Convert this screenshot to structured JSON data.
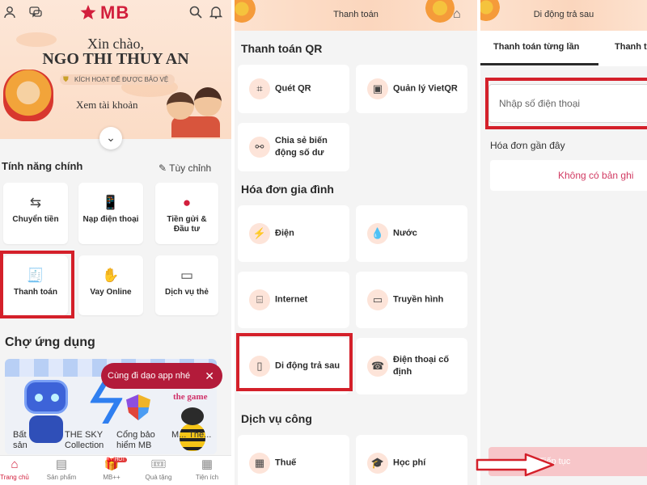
{
  "brand": {
    "name": "MB",
    "color": "#d21f3c",
    "highlight_color": "#d4202a"
  },
  "screen_home": {
    "greeting": "Xin chào,",
    "user_name": "NGO THI THUY AN",
    "protect_badge": "KÍCH HOẠT ĐỂ ĐƯỢC BẢO VỆ",
    "view_account": "Xem tài khoản",
    "main_features_title": "Tính năng chính",
    "customize_link": "Tùy chỉnh",
    "features": [
      {
        "label": "Chuyển tiền",
        "icon": "transfer-icon"
      },
      {
        "label": "Nạp điện thoại",
        "icon": "phone-topup-icon"
      },
      {
        "label": "Tiền gửi & Đầu tư",
        "icon": "savings-icon"
      },
      {
        "label": "Thanh toán",
        "icon": "bill-payment-icon"
      },
      {
        "label": "Vay Online",
        "icon": "loan-icon"
      },
      {
        "label": "Dịch vụ thẻ",
        "icon": "card-service-icon"
      }
    ],
    "app_market_title": "Chợ ứng dụng",
    "tooltip": "Cùng đi dạo app nhé",
    "tooltip_close": "✕",
    "market_apps": [
      "Bất sản",
      "THE SKY Collection",
      "Cổng bảo hiểm MB",
      "M... Thẻ..."
    ],
    "game_logo": "the game",
    "nav": [
      {
        "label": "Trang chủ",
        "icon": "home-icon"
      },
      {
        "label": "Sản phẩm",
        "icon": "folder-icon"
      },
      {
        "label": "MB++",
        "icon": "gift-icon",
        "badge": "HOT"
      },
      {
        "label": "Quà tặng",
        "icon": "voucher-icon"
      },
      {
        "label": "Tiện ích",
        "icon": "grid-icon"
      }
    ]
  },
  "screen_payment": {
    "title": "Thanh toán",
    "qr_section_title": "Thanh toán QR",
    "qr_items": [
      {
        "label": "Quét QR",
        "icon": "qr-scan-icon"
      },
      {
        "label": "Quản lý VietQR",
        "icon": "vietqr-manage-icon"
      },
      {
        "label": "Chia sẻ biến động số dư",
        "icon": "share-icon"
      }
    ],
    "family_section_title": "Hóa đơn gia đình",
    "family_items": [
      {
        "label": "Điện",
        "icon": "electricity-icon"
      },
      {
        "label": "Nước",
        "icon": "water-drop-icon"
      },
      {
        "label": "Internet",
        "icon": "router-icon"
      },
      {
        "label": "Truyền hình",
        "icon": "tv-icon"
      },
      {
        "label": "Di động trả sau",
        "icon": "mobile-icon"
      },
      {
        "label": "Điện thoại cố định",
        "icon": "landline-icon"
      }
    ],
    "public_section_title": "Dịch vụ công",
    "public_items": [
      {
        "label": "Thuế",
        "icon": "tax-icon"
      },
      {
        "label": "Học phí",
        "icon": "graduation-cap-icon"
      }
    ]
  },
  "screen_postpaid": {
    "title": "Di động trả sau",
    "tabs": [
      "Thanh toán từng lần",
      "Thanh t"
    ],
    "phone_placeholder": "Nhập số điện thoại",
    "recent_bills_title": "Hóa đơn gần đây",
    "no_records": "Không có bản ghi",
    "continue_button": "Tiếp tục"
  }
}
